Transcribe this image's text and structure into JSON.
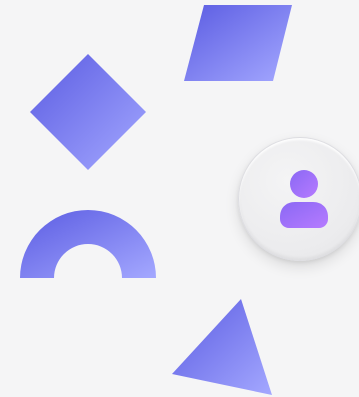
{
  "colors": {
    "background": "#f5f5f6",
    "shape_gradient_start": "#5b5ce2",
    "shape_gradient_end": "#a4a8ff",
    "avatar_gradient_start": "#8a68f4",
    "avatar_gradient_end": "#b67bff"
  },
  "shapes": [
    {
      "name": "parallelogram",
      "icon": "parallelogram-shape"
    },
    {
      "name": "diamond",
      "icon": "diamond-shape"
    },
    {
      "name": "arch",
      "icon": "arch-shape"
    },
    {
      "name": "triangle",
      "icon": "triangle-shape"
    }
  ],
  "avatar_button": {
    "icon": "user-icon"
  }
}
